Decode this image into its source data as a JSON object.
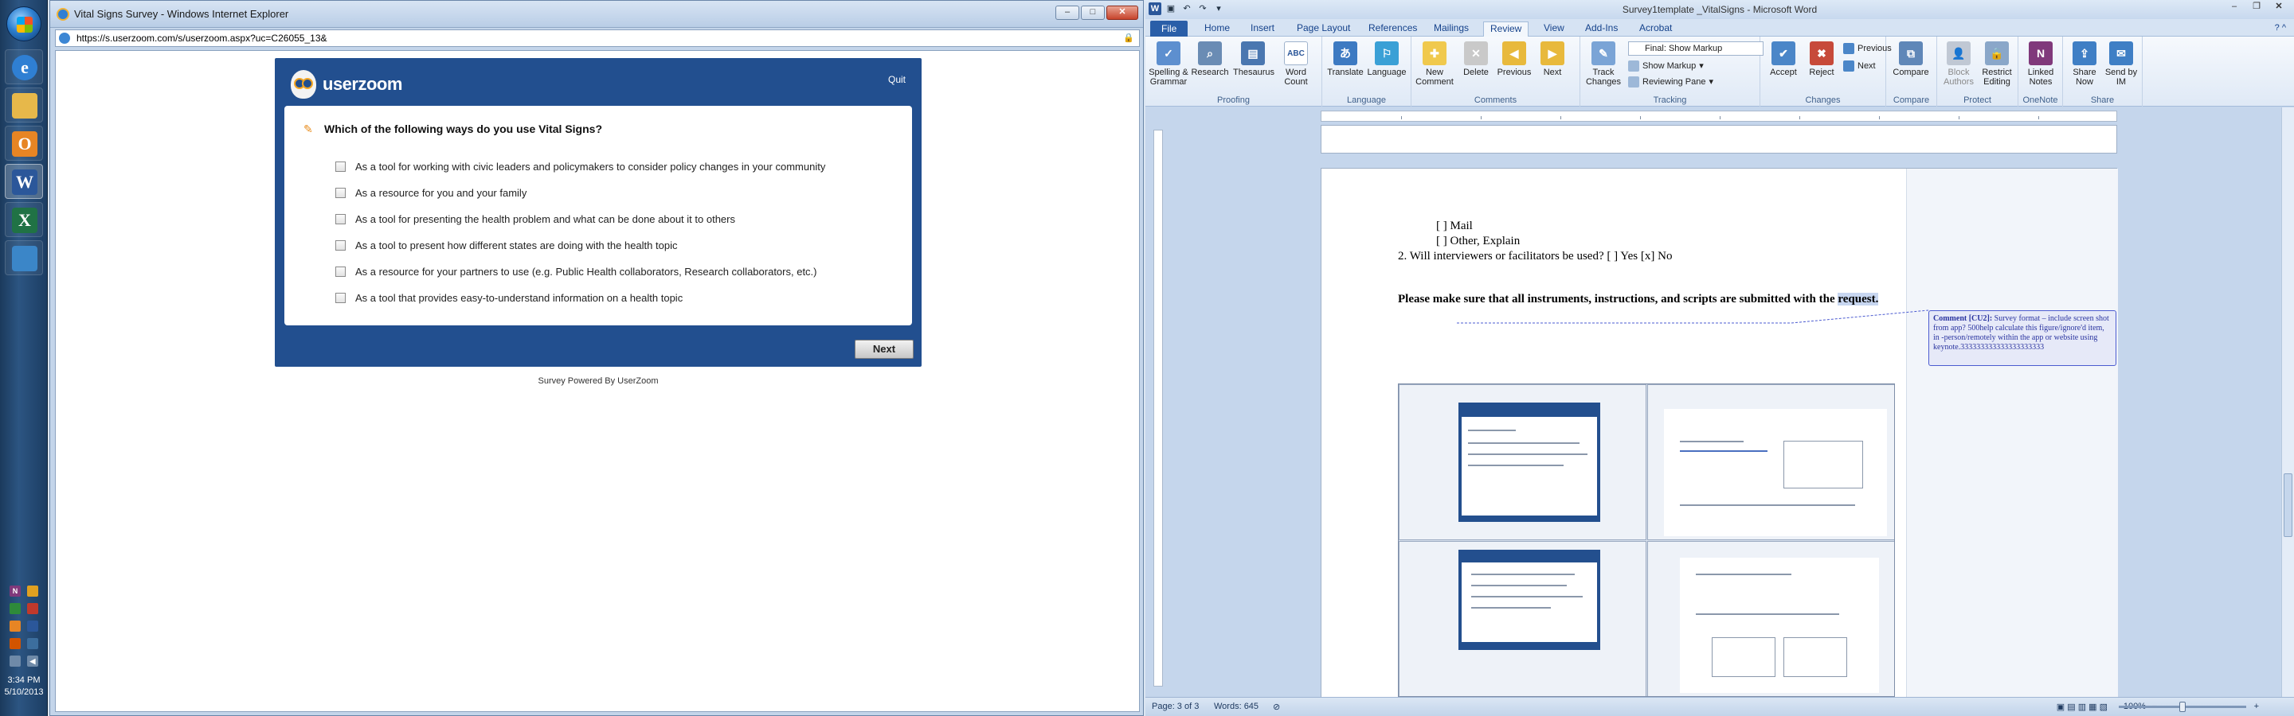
{
  "taskbar": {
    "apps": [
      {
        "name": "internet-explorer",
        "glyph": "e",
        "color": "#2f7fd3"
      },
      {
        "name": "file-explorer",
        "glyph": "",
        "color": "#e7b84a"
      },
      {
        "name": "outlook",
        "glyph": "O",
        "color": "#e78524"
      },
      {
        "name": "word",
        "glyph": "W",
        "color": "#2b579a"
      },
      {
        "name": "excel",
        "glyph": "X",
        "color": "#207245"
      },
      {
        "name": "remote-desktop",
        "glyph": "",
        "color": "#3b86c8"
      }
    ],
    "clock_time": "3:34 PM",
    "clock_date": "5/10/2013"
  },
  "ie": {
    "title": "Vital Signs Survey - Windows Internet Explorer",
    "url": "https://s.userzoom.com/s/userzoom.aspx?uc=C26055_13&",
    "survey": {
      "brand": "userzoom",
      "quit_label": "Quit",
      "question_prefix": "Which of the following ways do you use ",
      "question_brand": "Vital Signs",
      "question_suffix": "?",
      "options": [
        "As a tool for working with civic leaders and policymakers to consider policy changes in your community",
        "As a resource for you and your family",
        "As a tool for presenting the health problem and what can be done about it to others",
        "As a tool to present how different states are doing with the health topic",
        "As a resource for your partners to use (e.g. Public Health collaborators, Research collaborators, etc.)",
        "As a tool that provides easy-to-understand information on a health topic"
      ],
      "next_label": "Next",
      "powered_by": "Survey Powered By UserZoom"
    }
  },
  "word": {
    "title": "Survey1template _VitalSigns - Microsoft Word",
    "tabs": [
      "File",
      "Home",
      "Insert",
      "Page Layout",
      "References",
      "Mailings",
      "Review",
      "View",
      "Add-Ins",
      "Acrobat"
    ],
    "active_tab": "Review",
    "ribbon": {
      "proofing": {
        "label": "Proofing",
        "spelling": "Spelling & Grammar",
        "research": "Research",
        "thesaurus": "Thesaurus",
        "word_count": "Word Count"
      },
      "language": {
        "label": "Language",
        "translate": "Translate",
        "language": "Language"
      },
      "comments": {
        "label": "Comments",
        "new": "New Comment",
        "delete": "Delete",
        "previous": "Previous",
        "next": "Next"
      },
      "tracking": {
        "label": "Tracking",
        "track_changes": "Track Changes",
        "markup_select": "Final: Show Markup",
        "show_markup": "Show Markup",
        "reviewing_pane": "Reviewing Pane"
      },
      "changes": {
        "label": "Changes",
        "accept": "Accept",
        "reject": "Reject",
        "previous": "Previous",
        "next": "Next"
      },
      "compare": {
        "label": "Compare",
        "compare": "Compare"
      },
      "protect": {
        "label": "Protect",
        "block_authors": "Block Authors",
        "restrict_editing": "Restrict Editing"
      },
      "onenote": {
        "label": "OneNote",
        "linked_notes": "Linked Notes"
      },
      "share": {
        "label": "Share",
        "share_now": "Share Now",
        "send_by_im": "Send by IM"
      }
    },
    "doc": {
      "line_mail": "[  ] Mail",
      "line_other": "[  ] Other, Explain",
      "line_q2": "2.   Will interviewers  or facilitators be used?  [  ] Yes [x] No",
      "heading_main": "Please make sure that all instruments, instructions, and scripts are submitted with the ",
      "heading_hl": "request.",
      "comment_tag": "Comment [CU2]:",
      "comment_text": " Survey format – include screen shot from app? 500help calculate this figure/ignore'd item, in -person/remotely within the app or website using keynote.333333333333333333333"
    },
    "status": {
      "page": "Page: 3 of 3",
      "words": "Words: 645",
      "zoom": "100%"
    }
  }
}
